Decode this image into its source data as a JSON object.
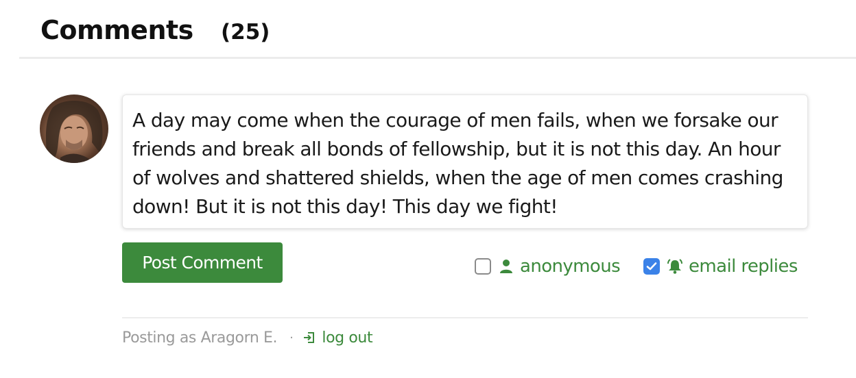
{
  "header": {
    "title": "Comments",
    "count": "(25)"
  },
  "composer": {
    "avatar_icon": "user-avatar-photo",
    "text": "A day may come when the courage of men fails, when we forsake our friends and break all bonds of fellowship, but it is not this day. An hour of wolves and shattered shields, when the age of men comes crashing down! But it is not this day! This day we fight!",
    "post_button_label": "Post Comment",
    "options": {
      "anonymous": {
        "label": "anonymous",
        "checked": false,
        "icon": "person-icon"
      },
      "email_replies": {
        "label": "email replies",
        "checked": true,
        "icon": "bell-icon"
      }
    }
  },
  "footer": {
    "posting_as": "Posting as Aragorn E.",
    "separator": "·",
    "logout_label": "log out",
    "logout_icon": "log-out-icon"
  },
  "colors": {
    "accent_green": "#3c8a3c",
    "checkbox_blue": "#3b82e8",
    "muted_text": "#9a9a9a"
  }
}
